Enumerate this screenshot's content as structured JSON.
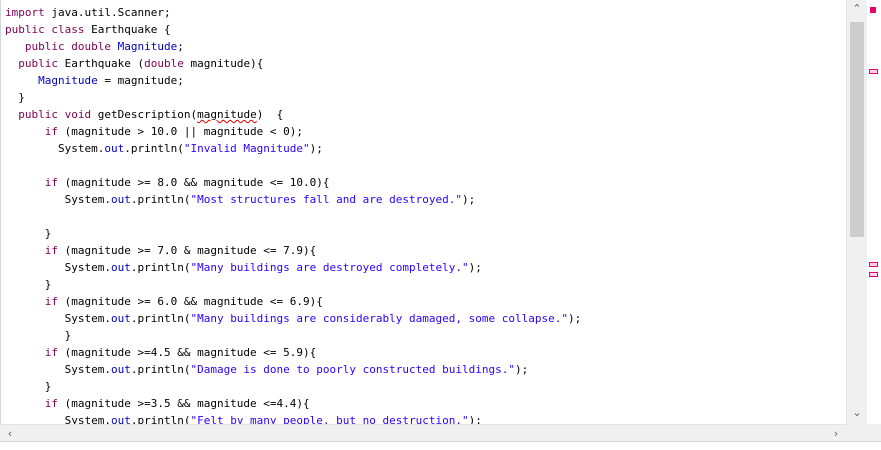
{
  "editor": {
    "lines": [
      [
        {
          "t": "import",
          "c": "kw"
        },
        {
          "t": " java.util.Scanner;"
        }
      ],
      [
        {
          "t": "public",
          "c": "kw"
        },
        {
          "t": " "
        },
        {
          "t": "class",
          "c": "kw"
        },
        {
          "t": " Earthquake {"
        }
      ],
      [
        {
          "t": "   "
        },
        {
          "t": "public",
          "c": "kw"
        },
        {
          "t": " "
        },
        {
          "t": "double",
          "c": "kw"
        },
        {
          "t": " "
        },
        {
          "t": "Magnitude",
          "c": "fld"
        },
        {
          "t": ";"
        }
      ],
      [
        {
          "t": "  "
        },
        {
          "t": "public",
          "c": "kw"
        },
        {
          "t": " Earthquake ("
        },
        {
          "t": "double",
          "c": "kw"
        },
        {
          "t": " magnitude){"
        }
      ],
      [
        {
          "t": "     "
        },
        {
          "t": "Magnitude",
          "c": "fld"
        },
        {
          "t": " = magnitude;"
        }
      ],
      [
        {
          "t": "  }"
        }
      ],
      [
        {
          "t": "  "
        },
        {
          "t": "public",
          "c": "kw"
        },
        {
          "t": " "
        },
        {
          "t": "void",
          "c": "kw"
        },
        {
          "t": " getDescription("
        },
        {
          "t": "magnitude",
          "c": "squig"
        },
        {
          "t": ")  {"
        }
      ],
      [
        {
          "t": "      "
        },
        {
          "t": "if",
          "c": "kw"
        },
        {
          "t": " (magnitude > 10.0 || magnitude < 0);"
        }
      ],
      [
        {
          "t": "        System."
        },
        {
          "t": "out",
          "c": "fld"
        },
        {
          "t": ".println("
        },
        {
          "t": "\"Invalid Magnitude\"",
          "c": "str"
        },
        {
          "t": ");"
        }
      ],
      [
        {
          "t": ""
        }
      ],
      [
        {
          "t": "      "
        },
        {
          "t": "if",
          "c": "kw"
        },
        {
          "t": " (magnitude >= 8.0 && magnitude <= 10.0){"
        }
      ],
      [
        {
          "t": "         System."
        },
        {
          "t": "out",
          "c": "fld"
        },
        {
          "t": ".println("
        },
        {
          "t": "\"Most structures fall and are destroyed.\"",
          "c": "str"
        },
        {
          "t": ");"
        }
      ],
      [
        {
          "t": ""
        }
      ],
      [
        {
          "t": "      }"
        }
      ],
      [
        {
          "t": "      "
        },
        {
          "t": "if",
          "c": "kw"
        },
        {
          "t": " (magnitude >= 7.0 & magnitude <= 7.9){"
        }
      ],
      [
        {
          "t": "         System."
        },
        {
          "t": "out",
          "c": "fld"
        },
        {
          "t": ".println("
        },
        {
          "t": "\"Many buildings are destroyed completely.\"",
          "c": "str"
        },
        {
          "t": ");"
        }
      ],
      [
        {
          "t": "      }"
        }
      ],
      [
        {
          "t": "      "
        },
        {
          "t": "if",
          "c": "kw"
        },
        {
          "t": " (magnitude >= 6.0 && magnitude <= 6.9){"
        }
      ],
      [
        {
          "t": "         System."
        },
        {
          "t": "out",
          "c": "fld"
        },
        {
          "t": ".println("
        },
        {
          "t": "\"Many buildings are considerably damaged, some collapse.\"",
          "c": "str"
        },
        {
          "t": ");"
        }
      ],
      [
        {
          "t": "         }"
        }
      ],
      [
        {
          "t": "      "
        },
        {
          "t": "if",
          "c": "kw"
        },
        {
          "t": " (magnitude >=4.5 && magnitude <= 5.9){"
        }
      ],
      [
        {
          "t": "         System."
        },
        {
          "t": "out",
          "c": "fld"
        },
        {
          "t": ".println("
        },
        {
          "t": "\"Damage is done to poorly constructed buildings.\"",
          "c": "str"
        },
        {
          "t": ");"
        }
      ],
      [
        {
          "t": "      }"
        }
      ],
      [
        {
          "t": "      "
        },
        {
          "t": "if",
          "c": "kw"
        },
        {
          "t": " (magnitude >=3.5 && magnitude <=4.4){"
        }
      ],
      [
        {
          "t": "         System."
        },
        {
          "t": "out",
          "c": "fld"
        },
        {
          "t": ".println("
        },
        {
          "t": "\"Felt by many people, but no destruction.\"",
          "c": "str"
        },
        {
          "t": ");"
        }
      ]
    ]
  },
  "scrollbars": {
    "up_arrow": "⌃",
    "down_arrow": "⌄",
    "left_arrow": "‹",
    "right_arrow": "›"
  },
  "colors": {
    "keyword": "#7f0055",
    "field": "#0000c0",
    "string": "#2a00ff",
    "error_marker": "#e8006f"
  }
}
